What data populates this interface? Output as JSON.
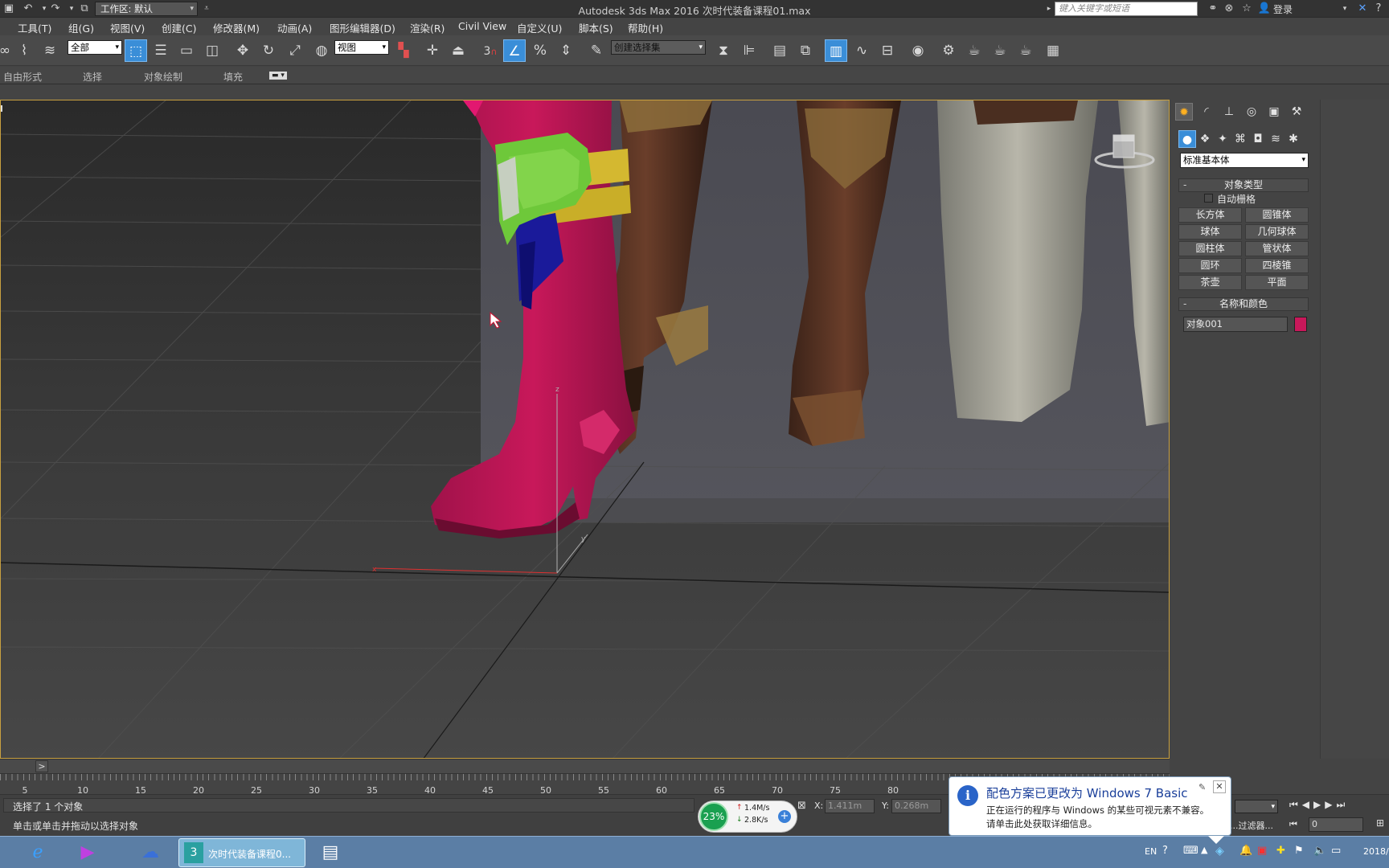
{
  "window": {
    "title": "Autodesk 3ds Max 2016     次时代装备课程01.max",
    "workspace_label": "工作区: 默认",
    "search_placeholder": "键入关键字或短语",
    "login_label": "登录"
  },
  "menubar": {
    "items": [
      "工具(T)",
      "组(G)",
      "视图(V)",
      "创建(C)",
      "修改器(M)",
      "动画(A)",
      "图形编辑器(D)",
      "渲染(R)",
      "Civil View",
      "自定义(U)",
      "脚本(S)",
      "帮助(H)"
    ]
  },
  "toolbar": {
    "selection_filter": "全部",
    "reference_coord": "视图",
    "snap_number": "3",
    "named_selection_set": "创建选择集"
  },
  "ribbon": {
    "tabs": [
      "自由形式",
      "选择",
      "对象绘制",
      "填充"
    ]
  },
  "command_panel": {
    "category_dropdown": "标准基本体",
    "object_type_title": "对象类型",
    "autogrid_label": "自动栅格",
    "object_buttons": [
      "长方体",
      "圆锥体",
      "球体",
      "几何球体",
      "圆柱体",
      "管状体",
      "圆环",
      "四棱锥",
      "茶壶",
      "平面"
    ],
    "name_color_title": "名称和颜色",
    "object_name": "对象001",
    "object_color": "#c8185a"
  },
  "timeline": {
    "ticks": [
      "5",
      "10",
      "15",
      "20",
      "25",
      "30",
      "35",
      "40",
      "45",
      "50",
      "55",
      "60",
      "65",
      "70",
      "75",
      "80"
    ],
    "slider_arrow": ">"
  },
  "status": {
    "line1": "选择了 1 个对象",
    "line2": "单击或单击并拖动以选择对象",
    "x_label": "X:",
    "x_value": "1.411m",
    "y_label": "Y:",
    "y_value": "0.268m",
    "frame_value": "0",
    "filter_label": "...过滤器..."
  },
  "network_widget": {
    "percent": "23%",
    "upload": "1.4M/s",
    "download": "2.8K/s"
  },
  "notification": {
    "title": "配色方案已更改为 Windows 7 Basic",
    "line1": "正在运行的程序与 Windows 的某些可视元素不兼容。",
    "line2": "请单击此处获取详细信息。"
  },
  "taskbar": {
    "active_task_label": "次时代装备课程0...",
    "tray_lang": "EN",
    "clock": "2018/"
  }
}
